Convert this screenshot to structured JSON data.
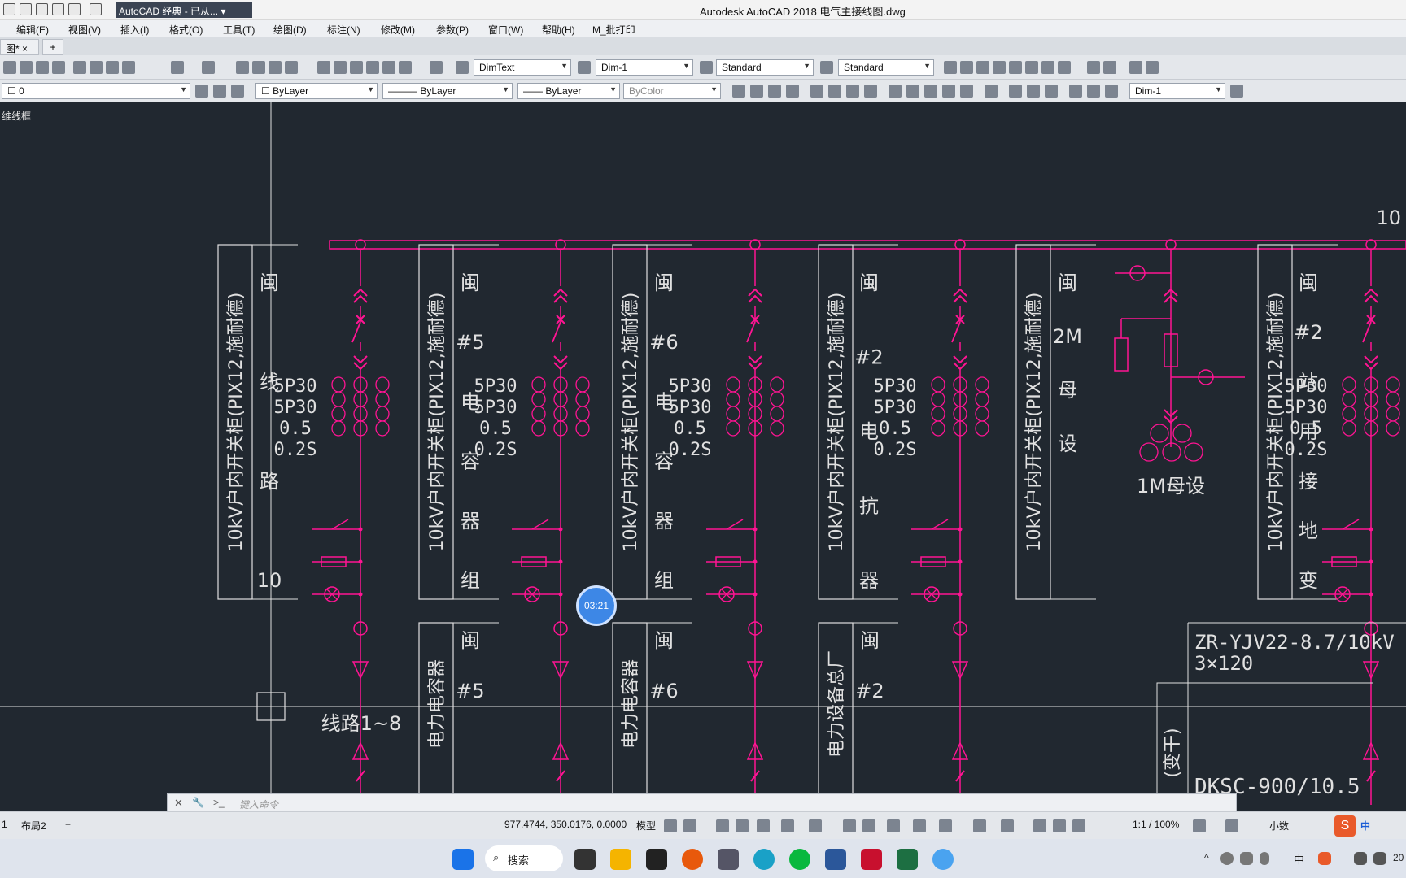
{
  "window": {
    "title": "Autodesk AutoCAD 2018    电气主接线图.dwg",
    "workspace": "AutoCAD 经典 - 已从..."
  },
  "menu": [
    "编辑(E)",
    "视图(V)",
    "插入(I)",
    "格式(O)",
    "工具(T)",
    "绘图(D)",
    "标注(N)",
    "修改(M)",
    "参数(P)",
    "窗口(W)",
    "帮助(H)",
    "M_批打印"
  ],
  "tabs": {
    "drawing": "图*",
    "add": "+"
  },
  "toolbar1": {
    "text_style": "DimText",
    "dim_style": "Dim-1",
    "table_style": "Standard",
    "multileader_style": "Standard"
  },
  "toolbar2": {
    "layer": "0",
    "color": "ByLayer",
    "linetype": "ByLayer",
    "lineweight": "ByLayer",
    "plotstyle": "ByColor",
    "dim_style2": "Dim-1"
  },
  "canvas": {
    "view_label": "维线框"
  },
  "drawing": {
    "panels": [
      {
        "title": "10kV户内开关柜(PIX12,施耐德)",
        "name": [
          "闽",
          "线",
          "路",
          "10"
        ],
        "ct": [
          "5P30",
          "5P30",
          "0.5",
          "0.2S"
        ]
      },
      {
        "title": "10kV户内开关柜(PIX12,施耐德)",
        "name": [
          "闽",
          "#5",
          "电",
          "容",
          "器",
          "组"
        ],
        "ct": [
          "5P30",
          "5P30",
          "0.5",
          "0.2S"
        ]
      },
      {
        "title": "10kV户内开关柜(PIX12,施耐德)",
        "name": [
          "闽",
          "#6",
          "电",
          "容",
          "器",
          "组"
        ],
        "ct": [
          "5P30",
          "5P30",
          "0.5",
          "0.2S"
        ]
      },
      {
        "title": "10kV户内开关柜(PIX12,施耐德)",
        "name": [
          "闽",
          "#2",
          "电",
          "抗",
          "器"
        ],
        "ct": [
          "5P30",
          "5P30",
          "0.5",
          "0.2S"
        ]
      },
      {
        "title": "10kV户内开关柜(PIX12,施耐德)",
        "name": [
          "闽",
          "2M",
          "母",
          "设"
        ],
        "ct": []
      },
      {
        "title": "10kV户内开关柜(PIX12,施耐德)",
        "name": [
          "闽",
          "#2",
          "站",
          "用",
          "接",
          "地",
          "变"
        ],
        "ct": [
          "5P30",
          "5P30",
          "0.5",
          "0.2S"
        ]
      }
    ],
    "bus_label": "1M母设",
    "lines_label": "线路1~8",
    "lower_panels": [
      {
        "title": "电力电容器",
        "name": [
          "闽",
          "#5"
        ]
      },
      {
        "title": "电力电容器",
        "name": [
          "闽",
          "#6"
        ]
      },
      {
        "title": "电力设备总厂",
        "name": [
          "闽",
          "#2"
        ]
      }
    ],
    "cable": [
      "ZR-YJV22-8.7/10kV",
      "3×120"
    ],
    "equipment": "DKSC-900/10.5",
    "equipment_side": "(变干)",
    "edge_number": "10",
    "timer": "03:21"
  },
  "command": {
    "placeholder": "键入命令"
  },
  "layout_tabs": [
    "1",
    "布局2",
    "+"
  ],
  "status": {
    "coords": "977.4744, 350.0176, 0.0000",
    "model": "模型",
    "scale": "1:1 / 100%",
    "units": "小数"
  },
  "taskbar": {
    "search": "搜索",
    "ime": "中",
    "time": "20"
  },
  "colors": {
    "magenta": "#ff1493",
    "bg": "#212830",
    "white": "#e0e0e0"
  }
}
